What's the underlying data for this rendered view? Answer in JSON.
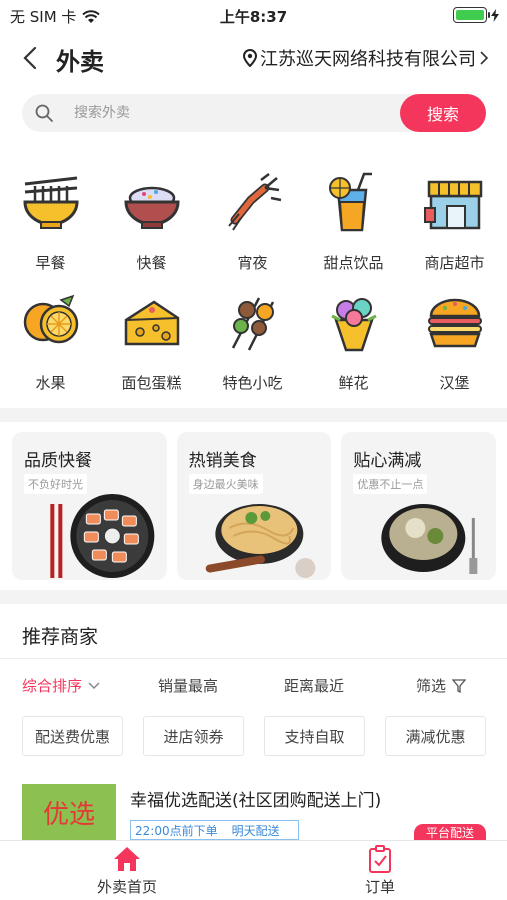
{
  "status_bar": {
    "carrier": "无 SIM 卡",
    "time": "上午8:37"
  },
  "header": {
    "back_icon": "chevron-left-icon",
    "title": "外卖",
    "location": "江苏巡天网络科技有限公司"
  },
  "search": {
    "placeholder": "搜索外卖",
    "button_label": "搜索"
  },
  "categories": [
    {
      "label": "早餐",
      "icon": "noodle-bowl-icon"
    },
    {
      "label": "快餐",
      "icon": "rice-bowl-icon"
    },
    {
      "label": "宵夜",
      "icon": "crayfish-icon"
    },
    {
      "label": "甜点饮品",
      "icon": "drink-cup-icon"
    },
    {
      "label": "商店超市",
      "icon": "store-icon"
    },
    {
      "label": "水果",
      "icon": "orange-icon"
    },
    {
      "label": "面包蛋糕",
      "icon": "cheese-cake-icon"
    },
    {
      "label": "特色小吃",
      "icon": "skewer-icon"
    },
    {
      "label": "鲜花",
      "icon": "flower-bouquet-icon"
    },
    {
      "label": "汉堡",
      "icon": "burger-icon"
    }
  ],
  "promos": [
    {
      "title": "品质快餐",
      "subtitle": "不负好时光"
    },
    {
      "title": "热销美食",
      "subtitle": "身边最火美味"
    },
    {
      "title": "贴心满减",
      "subtitle": "优惠不止一点"
    }
  ],
  "recommended": {
    "title": "推荐商家",
    "sort_options": [
      "综合排序",
      "销量最高",
      "距离最近",
      "筛选"
    ],
    "filters": [
      "配送费优惠",
      "进店领券",
      "支持自取",
      "满减优惠"
    ]
  },
  "shop": {
    "logo_text": "优选",
    "name": "幸福优选配送(社区团购配送上门)",
    "tag_order": "22:00点前下单",
    "tag_delivery": "明天配送",
    "badge": "平台配送"
  },
  "tab_bar": {
    "tabs": [
      {
        "label": "外卖首页",
        "icon": "home-icon",
        "active": true
      },
      {
        "label": "订单",
        "icon": "order-clipboard-icon",
        "active": false
      }
    ]
  },
  "colors": {
    "accent": "#f5365c",
    "battery": "#3fcc4f",
    "shop_logo_bg": "#8cc152"
  }
}
